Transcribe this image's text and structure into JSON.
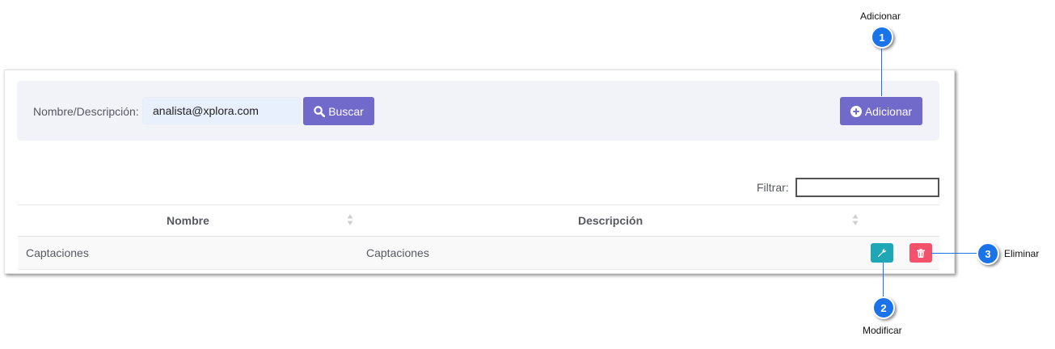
{
  "search": {
    "label": "Nombre/Descripción:",
    "value": "analista@xplora.com",
    "button_label": "Buscar"
  },
  "toolbar": {
    "add_label": "Adicionar"
  },
  "filter": {
    "label": "Filtrar:",
    "value": ""
  },
  "table": {
    "columns": [
      "Nombre",
      "Descripción"
    ],
    "rows": [
      {
        "nombre": "Captaciones",
        "descripcion": "Captaciones"
      }
    ]
  },
  "callouts": [
    {
      "number": "1",
      "label": "Adicionar"
    },
    {
      "number": "2",
      "label": "Modificar"
    },
    {
      "number": "3",
      "label": "Eliminar"
    }
  ],
  "colors": {
    "primary_button": "#716aca",
    "edit_button": "#20a7b5",
    "delete_button": "#f4516c",
    "callout": "#1a73e8"
  },
  "icons": {
    "search": "search-icon",
    "add": "plus-circle-icon",
    "edit": "wrench-icon",
    "delete": "trash-icon",
    "sort": "sort-icon"
  }
}
